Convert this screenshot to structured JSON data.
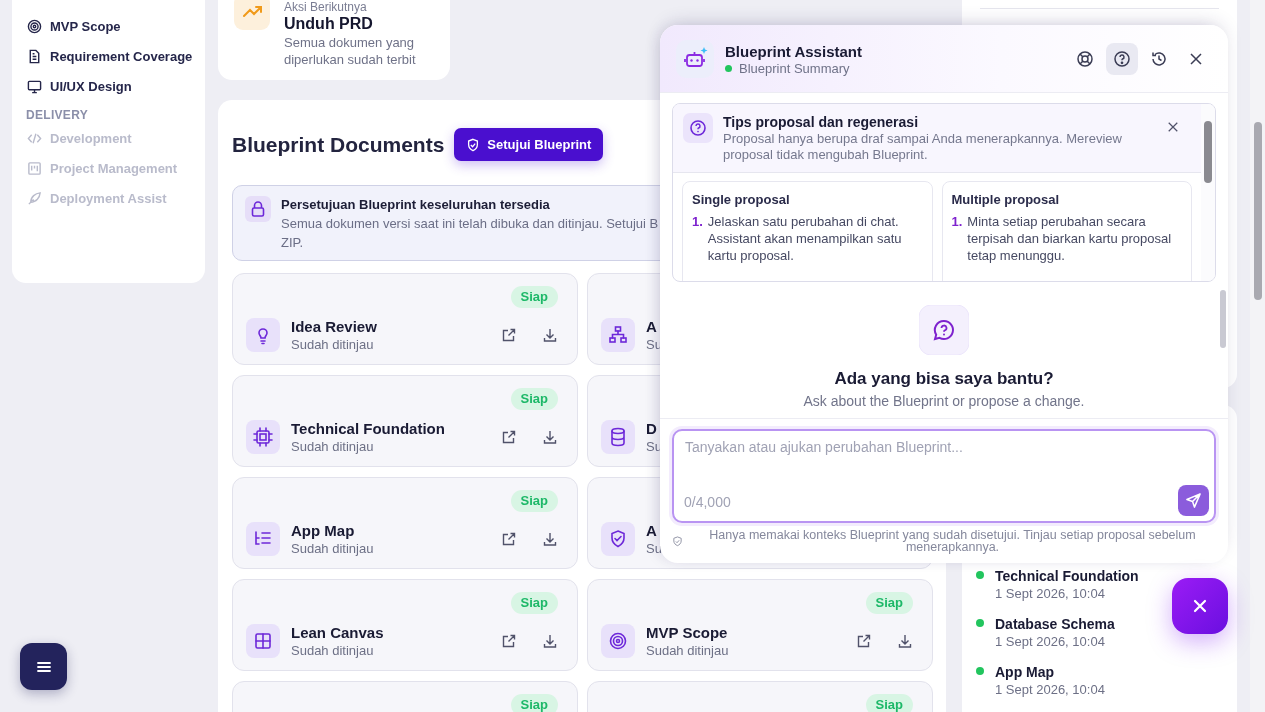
{
  "sidebar": {
    "groups": [
      {
        "items": [
          {
            "label": "MVP Scope",
            "disabled": false
          },
          {
            "label": "Requirement Coverage",
            "disabled": false
          },
          {
            "label": "UI/UX Design",
            "disabled": false
          }
        ]
      },
      {
        "heading": "DELIVERY",
        "items": [
          {
            "label": "Development",
            "disabled": true
          },
          {
            "label": "Project Management",
            "disabled": true
          },
          {
            "label": "Deployment Assist",
            "disabled": true
          }
        ]
      }
    ]
  },
  "next_action": {
    "eyebrow": "Aksi Berikutnya",
    "title": "Unduh PRD",
    "description": "Semua dokumen yang diperlukan sudah terbit"
  },
  "documents": {
    "title": "Blueprint Documents",
    "approve_button": "Setujui Blueprint",
    "notice": {
      "title": "Persetujuan Blueprint keseluruhan tersedia",
      "lines": [
        "Semua dokumen versi saat ini telah dibuka dan ditinjau. Setujui B",
        "ZIP."
      ]
    },
    "cards": [
      {
        "title": "Idea Review",
        "subtitle": "Sudah ditinjau",
        "badge": "Siap"
      },
      {
        "title": "A",
        "subtitle": "Su"
      },
      {
        "title": "Technical Foundation",
        "subtitle": "Sudah ditinjau",
        "badge": "Siap"
      },
      {
        "title": "D",
        "subtitle": "Su"
      },
      {
        "title": "App Map",
        "subtitle": "Sudah ditinjau",
        "badge": "Siap"
      },
      {
        "title": "A",
        "subtitle": "Su"
      },
      {
        "title": "Lean Canvas",
        "subtitle": "Sudah ditinjau",
        "badge": "Siap"
      },
      {
        "title": "MVP Scope",
        "subtitle": "Sudah ditinjau",
        "badge": "Siap"
      },
      {
        "badge": "Siap"
      },
      {
        "badge": "Siap"
      }
    ]
  },
  "activity": {
    "items": [
      {
        "title": "Technical Foundation",
        "time": "1 Sept 2026, 10:04",
        "color": "#22c55e"
      },
      {
        "title": "Database Schema",
        "time": "1 Sept 2026, 10:04",
        "color": "#22c55e"
      },
      {
        "title": "App Map",
        "time": "1 Sept 2026, 10:04",
        "color": "#22c55e"
      }
    ]
  },
  "assistant": {
    "title": "Blueprint Assistant",
    "status": "Blueprint Summary",
    "online": true,
    "header_buttons": [
      {
        "selected": false
      },
      {
        "selected": true
      },
      {
        "selected": false
      },
      {
        "selected": false
      }
    ],
    "tips": {
      "title": "Tips proposal dan regenerasi",
      "text": "Proposal hanya berupa draf sampai Anda menerapkannya. Mereview proposal tidak mengubah Blueprint.",
      "columns": [
        {
          "title": "Single proposal",
          "steps": [
            {
              "number": "1.",
              "text": "Jelaskan satu perubahan di chat. Assistant akan menampilkan satu kartu proposal."
            }
          ]
        },
        {
          "title": "Multiple proposal",
          "steps": [
            {
              "number": "1.",
              "text": "Minta setiap perubahan secara terpisah dan biarkan kartu proposal tetap menunggu."
            }
          ]
        }
      ]
    },
    "empty": {
      "title": "Ada yang bisa saya bantu?",
      "text": "Ask about the Blueprint or propose a change."
    },
    "input": {
      "placeholder": "Tanyakan atau ajukan perubahan Blueprint...",
      "counter": "0/4,000"
    },
    "note": "Hanya memakai konteks Blueprint yang sudah disetujui. Tinjau setiap proposal sebelum menerapkannya."
  }
}
